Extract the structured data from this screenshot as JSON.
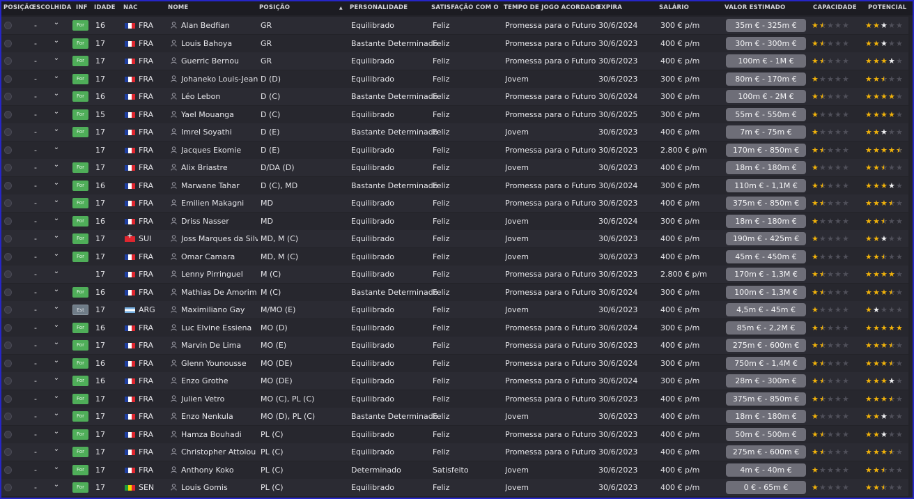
{
  "columns": {
    "position": "POSIÇÃO",
    "choice": "ESCOLHIDA",
    "inf": "INF",
    "age": "IDADE",
    "nat": "NAC",
    "name": "NOME",
    "pos": "POSIÇÃO",
    "personality": "PERSONALIDADE",
    "satisfaction": "SATISFAÇÃO COM O TE...",
    "playtime": "TEMPO DE JOGO ACORDADO",
    "expires": "EXPIRA",
    "salary": "SALÁRIO",
    "value": "VALOR ESTIMADO",
    "ability": "CAPACIDADE",
    "potential": "POTENCIAL"
  },
  "sort_indicator": "▲",
  "colors": {
    "star_gold": "#f2b30a",
    "star_white": "#f1f1f3",
    "badge_for": "#4fae59",
    "badge_est": "#6f7c88",
    "value_pill": "#6e6e78",
    "frame_border": "#2626c8"
  },
  "icons": {
    "select": "radio-circle-icon",
    "dropdown": "chevron-down-icon",
    "player": "person-icon"
  },
  "players": [
    {
      "choice": "-",
      "inf": "For",
      "age": "16",
      "nat": "FRA",
      "name": "Alan Bedfian",
      "pos": "GR",
      "personality": "Equilibrado",
      "satisfaction": "Feliz",
      "playtime": "Promessa para o Futuro",
      "expires": "30/6/2024",
      "salary": "300 € p/m",
      "value": "35m € - 325m €",
      "ability": 1.5,
      "potential": 3,
      "pot_white": 1
    },
    {
      "choice": "-",
      "inf": "For",
      "age": "17",
      "nat": "FRA",
      "name": "Louis Bahoya",
      "pos": "GR",
      "personality": "Bastante Determinado",
      "satisfaction": "Feliz",
      "playtime": "Promessa para o Futuro",
      "expires": "30/6/2023",
      "salary": "400 € p/m",
      "value": "30m € - 300m €",
      "ability": 1.5,
      "potential": 3,
      "pot_white": 1
    },
    {
      "choice": "-",
      "inf": "For",
      "age": "17",
      "nat": "FRA",
      "name": "Guerric Bernou",
      "pos": "GR",
      "personality": "Equilibrado",
      "satisfaction": "Feliz",
      "playtime": "Promessa para o Futuro",
      "expires": "30/6/2023",
      "salary": "400 € p/m",
      "value": "100m € - 1M €",
      "ability": 1.5,
      "potential": 4,
      "pot_white": 1
    },
    {
      "choice": "-",
      "inf": "For",
      "age": "17",
      "nat": "FRA",
      "name": "Johaneko Louis-Jean",
      "pos": "D (D)",
      "personality": "Equilibrado",
      "satisfaction": "Feliz",
      "playtime": "Jovem",
      "expires": "30/6/2023",
      "salary": "300 € p/m",
      "value": "80m € - 170m €",
      "ability": 1,
      "potential": 2.5,
      "pot_white": 0
    },
    {
      "choice": "-",
      "inf": "For",
      "age": "16",
      "nat": "FRA",
      "name": "Léo Lebon",
      "pos": "D (C)",
      "personality": "Bastante Determinado",
      "satisfaction": "Feliz",
      "playtime": "Promessa para o Futuro",
      "expires": "30/6/2024",
      "salary": "300 € p/m",
      "value": "100m € - 2M €",
      "ability": 1.5,
      "potential": 4,
      "pot_white": 0
    },
    {
      "choice": "-",
      "inf": "For",
      "age": "15",
      "nat": "FRA",
      "name": "Yael Mouanga",
      "pos": "D (C)",
      "personality": "Equilibrado",
      "satisfaction": "Feliz",
      "playtime": "Promessa para o Futuro",
      "expires": "30/6/2025",
      "salary": "300 € p/m",
      "value": "55m € - 550m €",
      "ability": 1,
      "potential": 4,
      "pot_white": 0
    },
    {
      "choice": "-",
      "inf": "For",
      "age": "17",
      "nat": "FRA",
      "name": "Imrel Soyathi",
      "pos": "D (E)",
      "personality": "Bastante Determinado",
      "satisfaction": "Feliz",
      "playtime": "Jovem",
      "expires": "30/6/2023",
      "salary": "400 € p/m",
      "value": "7m € - 75m €",
      "ability": 1,
      "potential": 3,
      "pot_white": 1
    },
    {
      "choice": "-",
      "inf": "",
      "age": "17",
      "nat": "FRA",
      "name": "Jacques Ekomie",
      "pos": "D (E)",
      "personality": "Equilibrado",
      "satisfaction": "Feliz",
      "playtime": "Promessa para o Futuro",
      "expires": "30/6/2023",
      "salary": "2.800 € p/m",
      "value": "170m € - 850m €",
      "ability": 1.5,
      "potential": 4.5,
      "pot_white": 0
    },
    {
      "choice": "-",
      "inf": "For",
      "age": "17",
      "nat": "FRA",
      "name": "Alix Briastre",
      "pos": "D/DA (D)",
      "personality": "Equilibrado",
      "satisfaction": "Feliz",
      "playtime": "Jovem",
      "expires": "30/6/2023",
      "salary": "400 € p/m",
      "value": "18m € - 180m €",
      "ability": 1,
      "potential": 2.5,
      "pot_white": 0
    },
    {
      "choice": "-",
      "inf": "For",
      "age": "16",
      "nat": "FRA",
      "name": "Marwane Tahar",
      "pos": "D (C), MD",
      "personality": "Bastante Determinado",
      "satisfaction": "Feliz",
      "playtime": "Promessa para o Futuro",
      "expires": "30/6/2024",
      "salary": "300 € p/m",
      "value": "110m € - 1,1M €",
      "ability": 1.5,
      "potential": 4,
      "pot_white": 1
    },
    {
      "choice": "-",
      "inf": "For",
      "age": "17",
      "nat": "FRA",
      "name": "Emilien Makagni",
      "pos": "MD",
      "personality": "Equilibrado",
      "satisfaction": "Feliz",
      "playtime": "Promessa para o Futuro",
      "expires": "30/6/2023",
      "salary": "400 € p/m",
      "value": "375m € - 850m €",
      "ability": 1.5,
      "potential": 3.5,
      "pot_white": 0
    },
    {
      "choice": "-",
      "inf": "For",
      "age": "16",
      "nat": "FRA",
      "name": "Driss Nasser",
      "pos": "MD",
      "personality": "Equilibrado",
      "satisfaction": "Feliz",
      "playtime": "Jovem",
      "expires": "30/6/2024",
      "salary": "300 € p/m",
      "value": "18m € - 180m €",
      "ability": 1,
      "potential": 2.5,
      "pot_white": 0
    },
    {
      "choice": "-",
      "inf": "For",
      "age": "17",
      "nat": "SUI",
      "name": "Joss Marques da Silva",
      "pos": "MD, M (C)",
      "personality": "Equilibrado",
      "satisfaction": "Feliz",
      "playtime": "Jovem",
      "expires": "30/6/2023",
      "salary": "400 € p/m",
      "value": "190m € - 425m €",
      "ability": 1,
      "potential": 3,
      "pot_white": 1
    },
    {
      "choice": "-",
      "inf": "For",
      "age": "17",
      "nat": "FRA",
      "name": "Omar Camara",
      "pos": "MD, M (C)",
      "personality": "Equilibrado",
      "satisfaction": "Feliz",
      "playtime": "Jovem",
      "expires": "30/6/2023",
      "salary": "400 € p/m",
      "value": "45m € - 450m €",
      "ability": 1,
      "potential": 2.5,
      "pot_white": 0
    },
    {
      "choice": "-",
      "inf": "",
      "age": "17",
      "nat": "FRA",
      "name": "Lenny Pirringuel",
      "pos": "M (C)",
      "personality": "Equilibrado",
      "satisfaction": "Feliz",
      "playtime": "Promessa para o Futuro",
      "expires": "30/6/2023",
      "salary": "2.800 € p/m",
      "value": "170m € - 1,3M €",
      "ability": 1.5,
      "potential": 4,
      "pot_white": 0
    },
    {
      "choice": "-",
      "inf": "For",
      "age": "16",
      "nat": "FRA",
      "name": "Mathias De Amorim",
      "pos": "M (C)",
      "personality": "Bastante Determinado",
      "satisfaction": "Feliz",
      "playtime": "Promessa para o Futuro",
      "expires": "30/6/2024",
      "salary": "300 € p/m",
      "value": "100m € - 1,3M €",
      "ability": 1.5,
      "potential": 3.5,
      "pot_white": 0
    },
    {
      "choice": "-",
      "inf": "Est",
      "age": "17",
      "nat": "ARG",
      "name": "Maximiliano Gay",
      "pos": "M/MO (E)",
      "personality": "Equilibrado",
      "satisfaction": "Feliz",
      "playtime": "Jovem",
      "expires": "30/6/2023",
      "salary": "400 € p/m",
      "value": "4,5m € - 45m €",
      "ability": 1,
      "potential": 2,
      "pot_white": 1
    },
    {
      "choice": "-",
      "inf": "For",
      "age": "16",
      "nat": "FRA",
      "name": "Luc Elvine Essiena",
      "pos": "MO (D)",
      "personality": "Equilibrado",
      "satisfaction": "Feliz",
      "playtime": "Promessa para o Futuro",
      "expires": "30/6/2024",
      "salary": "300 € p/m",
      "value": "85m € - 2,2M €",
      "ability": 1.5,
      "potential": 5,
      "pot_white": 0
    },
    {
      "choice": "-",
      "inf": "For",
      "age": "17",
      "nat": "FRA",
      "name": "Marvin De Lima",
      "pos": "MO (E)",
      "personality": "Equilibrado",
      "satisfaction": "Feliz",
      "playtime": "Promessa para o Futuro",
      "expires": "30/6/2023",
      "salary": "400 € p/m",
      "value": "275m € - 600m €",
      "ability": 1.5,
      "potential": 3.5,
      "pot_white": 0
    },
    {
      "choice": "-",
      "inf": "For",
      "age": "16",
      "nat": "FRA",
      "name": "Glenn Younousse",
      "pos": "MO (DE)",
      "personality": "Equilibrado",
      "satisfaction": "Feliz",
      "playtime": "Promessa para o Futuro",
      "expires": "30/6/2024",
      "salary": "300 € p/m",
      "value": "750m € - 1,4M €",
      "ability": 1.5,
      "potential": 3.5,
      "pot_white": 0
    },
    {
      "choice": "-",
      "inf": "For",
      "age": "16",
      "nat": "FRA",
      "name": "Enzo Grothe",
      "pos": "MO (DE)",
      "personality": "Equilibrado",
      "satisfaction": "Feliz",
      "playtime": "Promessa para o Futuro",
      "expires": "30/6/2024",
      "salary": "300 € p/m",
      "value": "28m € - 300m €",
      "ability": 1.5,
      "potential": 4,
      "pot_white": 1
    },
    {
      "choice": "-",
      "inf": "For",
      "age": "17",
      "nat": "FRA",
      "name": "Julien Vetro",
      "pos": "MO (C), PL (C)",
      "personality": "Equilibrado",
      "satisfaction": "Feliz",
      "playtime": "Promessa para o Futuro",
      "expires": "30/6/2023",
      "salary": "400 € p/m",
      "value": "375m € - 850m €",
      "ability": 1.5,
      "potential": 3.5,
      "pot_white": 0
    },
    {
      "choice": "-",
      "inf": "For",
      "age": "17",
      "nat": "FRA",
      "name": "Enzo Nenkula",
      "pos": "MO (D), PL (C)",
      "personality": "Bastante Determinado",
      "satisfaction": "Feliz",
      "playtime": "Jovem",
      "expires": "30/6/2023",
      "salary": "400 € p/m",
      "value": "18m € - 180m €",
      "ability": 1,
      "potential": 3,
      "pot_white": 1
    },
    {
      "choice": "-",
      "inf": "For",
      "age": "17",
      "nat": "FRA",
      "name": "Hamza Bouhadi",
      "pos": "PL (C)",
      "personality": "Equilibrado",
      "satisfaction": "Feliz",
      "playtime": "Promessa para o Futuro",
      "expires": "30/6/2023",
      "salary": "400 € p/m",
      "value": "50m € - 500m €",
      "ability": 1.5,
      "potential": 3,
      "pot_white": 1
    },
    {
      "choice": "-",
      "inf": "For",
      "age": "17",
      "nat": "FRA",
      "name": "Christopher Attolou",
      "pos": "PL (C)",
      "personality": "Equilibrado",
      "satisfaction": "Feliz",
      "playtime": "Promessa para o Futuro",
      "expires": "30/6/2023",
      "salary": "400 € p/m",
      "value": "275m € - 600m €",
      "ability": 1.5,
      "potential": 3.5,
      "pot_white": 0
    },
    {
      "choice": "-",
      "inf": "For",
      "age": "17",
      "nat": "FRA",
      "name": "Anthony Koko",
      "pos": "PL (C)",
      "personality": "Determinado",
      "satisfaction": "Satisfeito",
      "playtime": "Jovem",
      "expires": "30/6/2023",
      "salary": "400 € p/m",
      "value": "4m € - 40m €",
      "ability": 1,
      "potential": 2.5,
      "pot_white": 0
    },
    {
      "choice": "-",
      "inf": "For",
      "age": "17",
      "nat": "SEN",
      "name": "Louis Gomis",
      "pos": "PL (C)",
      "personality": "Equilibrado",
      "satisfaction": "Feliz",
      "playtime": "Jovem",
      "expires": "30/6/2023",
      "salary": "400 € p/m",
      "value": "0 € - 65m €",
      "ability": 1,
      "potential": 2.5,
      "pot_white": 0
    }
  ]
}
